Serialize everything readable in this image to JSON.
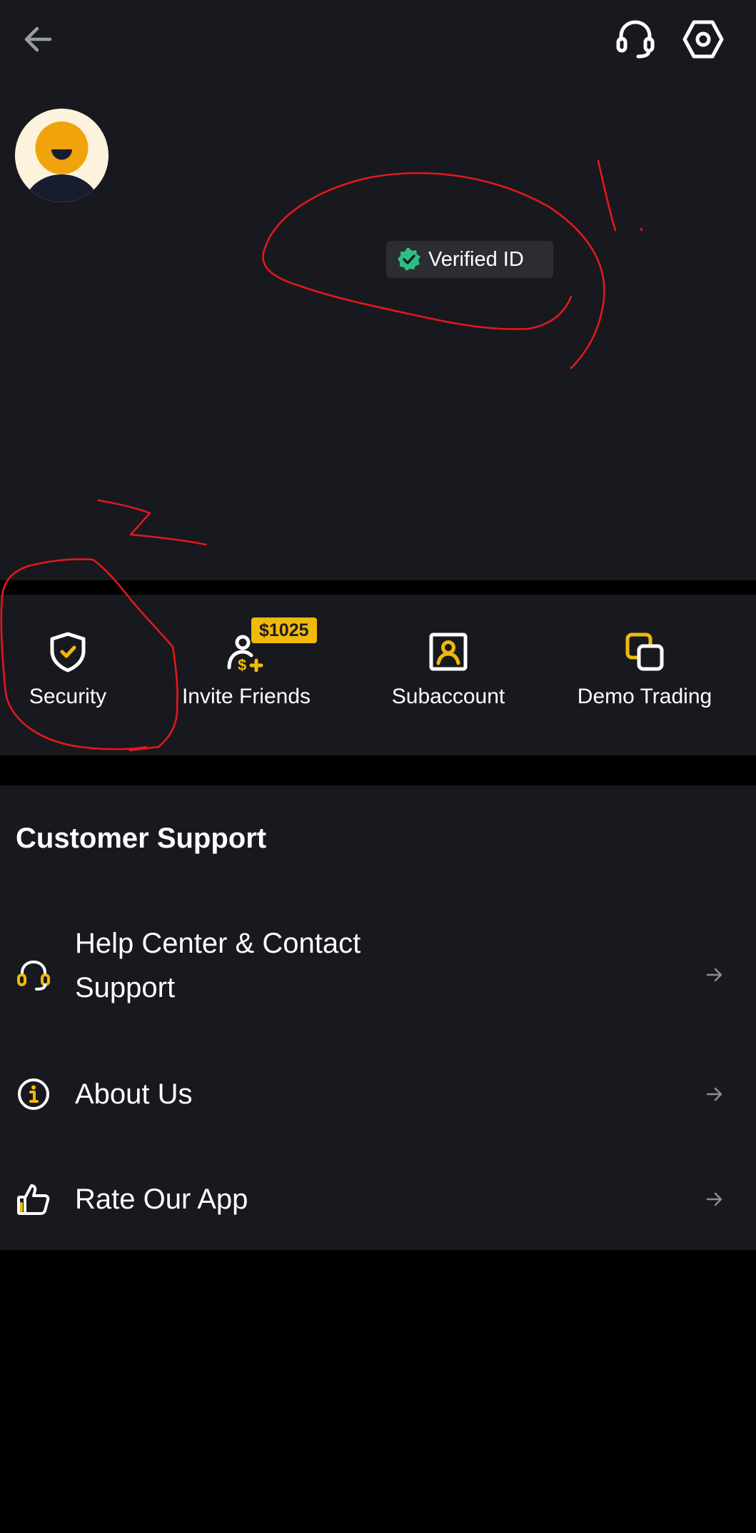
{
  "header": {
    "back_icon": "arrow-left-icon",
    "support_icon": "headset-icon",
    "settings_icon": "hexagon-gear-icon"
  },
  "profile": {
    "avatar_icon": "smiley-avatar",
    "verified_label": "Verified ID",
    "verified_icon": "verified-check-icon"
  },
  "annotations": {
    "mark_1": "1",
    "mark_2": "2"
  },
  "quick_actions": [
    {
      "label": "Security",
      "icon": "shield-check-icon"
    },
    {
      "label": "Invite Friends",
      "icon": "person-dollar-icon",
      "badge": "$1025"
    },
    {
      "label": "Subaccount",
      "icon": "user-square-icon"
    },
    {
      "label": "Demo Trading",
      "icon": "overlapping-squares-icon"
    }
  ],
  "customer_support": {
    "title": "Customer Support",
    "items": [
      {
        "label": "Help Center & Contact Support",
        "icon": "headset-icon"
      },
      {
        "label": "About Us",
        "icon": "info-icon"
      },
      {
        "label": "Rate Our App",
        "icon": "thumbs-up-icon"
      }
    ]
  },
  "colors": {
    "background": "#000000",
    "surface": "#18191e",
    "accent": "#f0b90b",
    "verified_green": "#2ebd85",
    "annotation_red": "#e0191e"
  }
}
